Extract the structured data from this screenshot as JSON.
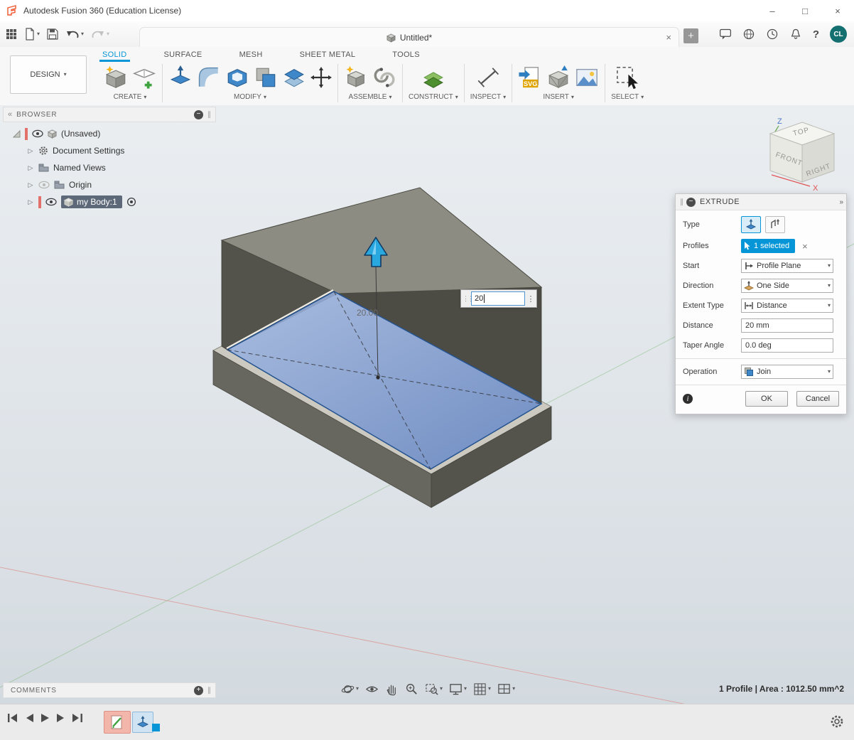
{
  "titlebar": {
    "title": "Autodesk Fusion 360 (Education License)"
  },
  "quick_toolbar": {
    "tab": {
      "label": "Untitled*"
    },
    "avatar": "CL"
  },
  "ribbon": {
    "design_button": "DESIGN",
    "tabs": [
      {
        "label": "SOLID",
        "active": true
      },
      {
        "label": "SURFACE"
      },
      {
        "label": "MESH"
      },
      {
        "label": "SHEET METAL"
      },
      {
        "label": "TOOLS"
      }
    ],
    "groups": [
      {
        "label": "CREATE"
      },
      {
        "label": "MODIFY"
      },
      {
        "label": "ASSEMBLE"
      },
      {
        "label": "CONSTRUCT"
      },
      {
        "label": "INSPECT"
      },
      {
        "label": "INSERT"
      },
      {
        "label": "SELECT"
      }
    ]
  },
  "browser": {
    "title": "BROWSER",
    "items": [
      {
        "label": "(Unsaved)"
      },
      {
        "label": "Document Settings"
      },
      {
        "label": "Named Views"
      },
      {
        "label": "Origin"
      },
      {
        "label": "my Body:1"
      }
    ]
  },
  "viewcube": {
    "top": "TOP",
    "front": "FRONT",
    "right": "RIGHT",
    "axis_z": "Z",
    "axis_x": "X"
  },
  "extrude_dialog": {
    "title": "EXTRUDE",
    "type_label": "Type",
    "profiles_label": "Profiles",
    "profiles_value": "1 selected",
    "start_label": "Start",
    "start_value": "Profile Plane",
    "direction_label": "Direction",
    "direction_value": "One Side",
    "extent_label": "Extent Type",
    "extent_value": "Distance",
    "distance_label": "Distance",
    "distance_value": "20 mm",
    "taper_label": "Taper Angle",
    "taper_value": "0.0 deg",
    "operation_label": "Operation",
    "operation_value": "Join",
    "ok": "OK",
    "cancel": "Cancel"
  },
  "viewport": {
    "manipulator_value": "20",
    "dimension_label": "20.00"
  },
  "insert": {
    "svg_badge": "SVG"
  },
  "comments_panel": {
    "title": "COMMENTS"
  },
  "status": {
    "selection_info": "1 Profile | Area : 1012.50 mm^2"
  },
  "colors": {
    "accent_blue": "#0696d7",
    "selection_face": "#6f94d0",
    "logo_orange": "#f0552b",
    "timeline_pink": "#f3b6ab"
  },
  "icons": {
    "caret_down": "▾",
    "minimize": "–",
    "maximize": "□",
    "close": "×",
    "tab_close": "×",
    "new_tab": "+",
    "grip": "∥",
    "collapse_left": "«",
    "panel_minus": "−",
    "dock_right": "»",
    "ellipsis_v": "⋮",
    "grip_dots": "⋮⋮",
    "info": "i",
    "help": "?",
    "expand_arrow": "▷",
    "comments_plus": "+"
  }
}
